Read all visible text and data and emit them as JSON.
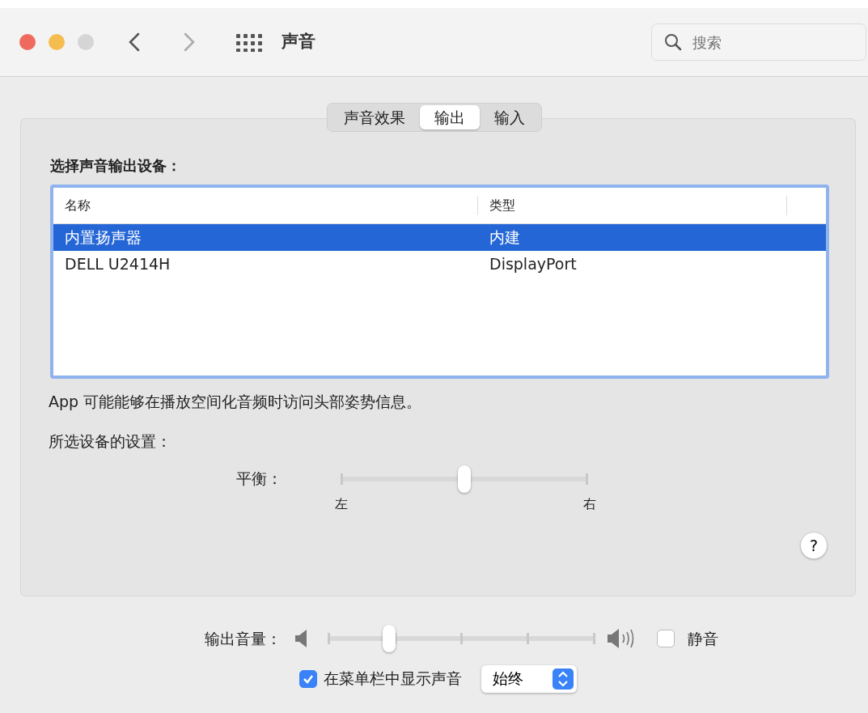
{
  "window": {
    "title": "声音",
    "search": {
      "placeholder": "搜索"
    }
  },
  "tabs": [
    {
      "label": "声音效果",
      "selected": false
    },
    {
      "label": "输出",
      "selected": true
    },
    {
      "label": "输入",
      "selected": false
    }
  ],
  "device_section": {
    "heading": "选择声音输出设备：",
    "table": {
      "columns": [
        "名称",
        "类型"
      ],
      "rows": [
        {
          "cells": [
            "内置扬声器",
            "内建"
          ],
          "selected": true
        },
        {
          "cells": [
            "DELL U2414H",
            "DisplayPort"
          ],
          "selected": false
        }
      ]
    }
  },
  "note": "App 可能能够在播放空间化音频时访问头部姿势信息。",
  "settings_heading": "所选设备的设置：",
  "balance": {
    "label": "平衡：",
    "level": 0.5,
    "left": "左",
    "right": "右"
  },
  "help": "?",
  "volume": {
    "label": "输出音量：",
    "level": 0.23,
    "mute": {
      "label": "静音",
      "checked": false
    }
  },
  "menu_bar": {
    "label": "在菜单栏中显示声音",
    "checked": true,
    "popup": "始终"
  }
}
